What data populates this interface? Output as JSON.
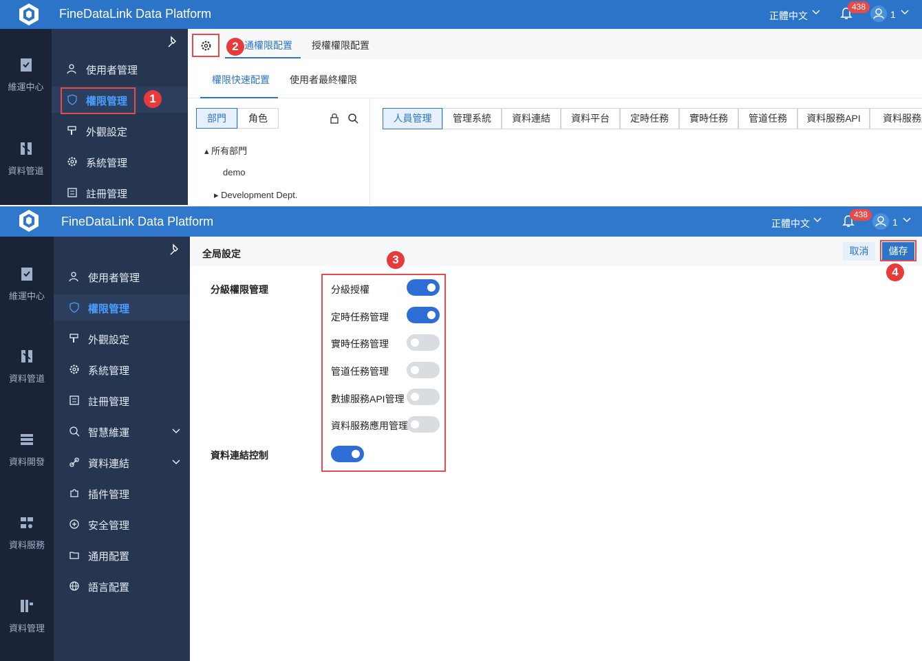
{
  "header": {
    "brand": "FineDataLink Data Platform",
    "language": "正體中文",
    "notification_count": "438",
    "user": "1"
  },
  "left_nav": [
    {
      "label": "維運中心",
      "icon": "clipboard-check-icon"
    },
    {
      "label": "資料管道",
      "icon": "pipeline-icon"
    },
    {
      "label": "資料開發",
      "icon": "server-stack-icon"
    },
    {
      "label": "資料服務",
      "icon": "service-icon"
    },
    {
      "label": "資料管理",
      "icon": "data-manage-icon"
    }
  ],
  "side_nav": {
    "top": [
      {
        "label": "使用者管理",
        "icon": "user-manage-icon"
      },
      {
        "label": "權限管理",
        "icon": "shield-icon",
        "active": true
      },
      {
        "label": "外觀設定",
        "icon": "paint-roller-icon"
      },
      {
        "label": "系統管理",
        "icon": "gear-icon"
      },
      {
        "label": "註冊管理",
        "icon": "register-icon"
      }
    ],
    "bottom": [
      {
        "label": "使用者管理",
        "icon": "user-manage-icon"
      },
      {
        "label": "權限管理",
        "icon": "shield-icon",
        "active": true
      },
      {
        "label": "外觀設定",
        "icon": "paint-roller-icon"
      },
      {
        "label": "系統管理",
        "icon": "gear-icon"
      },
      {
        "label": "註冊管理",
        "icon": "register-icon"
      },
      {
        "label": "智慧維運",
        "icon": "smart-ops-icon",
        "expandable": true
      },
      {
        "label": "資料連結",
        "icon": "link-icon",
        "expandable": true
      },
      {
        "label": "插件管理",
        "icon": "puzzle-icon"
      },
      {
        "label": "安全管理",
        "icon": "security-icon"
      },
      {
        "label": "通用配置",
        "icon": "folder-config-icon"
      },
      {
        "label": "語言配置",
        "icon": "globe-icon"
      }
    ]
  },
  "top_tabs": [
    "通權限配置",
    "授權權限配置"
  ],
  "sub_tabs": [
    "權限快速配置",
    "使用者最終權限"
  ],
  "segments": [
    "部門",
    "角色"
  ],
  "tree": {
    "root": "所有部門",
    "children": [
      "demo",
      "Development Dept."
    ]
  },
  "perm_tabs": [
    "人員管理",
    "管理系統",
    "資料連結",
    "資料平台",
    "定時任務",
    "實時任務",
    "管道任務",
    "資料服務API",
    "資料服務應"
  ],
  "markers": [
    "1",
    "2",
    "3",
    "4"
  ],
  "global_settings": {
    "title": "全局設定",
    "cancel": "取消",
    "save": "儲存",
    "hierarchy_label": "分級權限管理",
    "options": [
      {
        "label": "分級授權",
        "on": true
      },
      {
        "label": "定時任務管理",
        "on": true
      },
      {
        "label": "實時任務管理",
        "on": false
      },
      {
        "label": "管道任務管理",
        "on": false
      },
      {
        "label": "數據服務API管理",
        "on": false
      },
      {
        "label": "資料服務應用管理",
        "on": false
      }
    ],
    "conn_label": "資料連結控制",
    "conn_on": true
  },
  "colors": {
    "header": "#2b74c8",
    "nav_dark": "#1a2436",
    "nav": "#263550",
    "accent": "#2e6cd6",
    "marker": "#e83a3a"
  }
}
